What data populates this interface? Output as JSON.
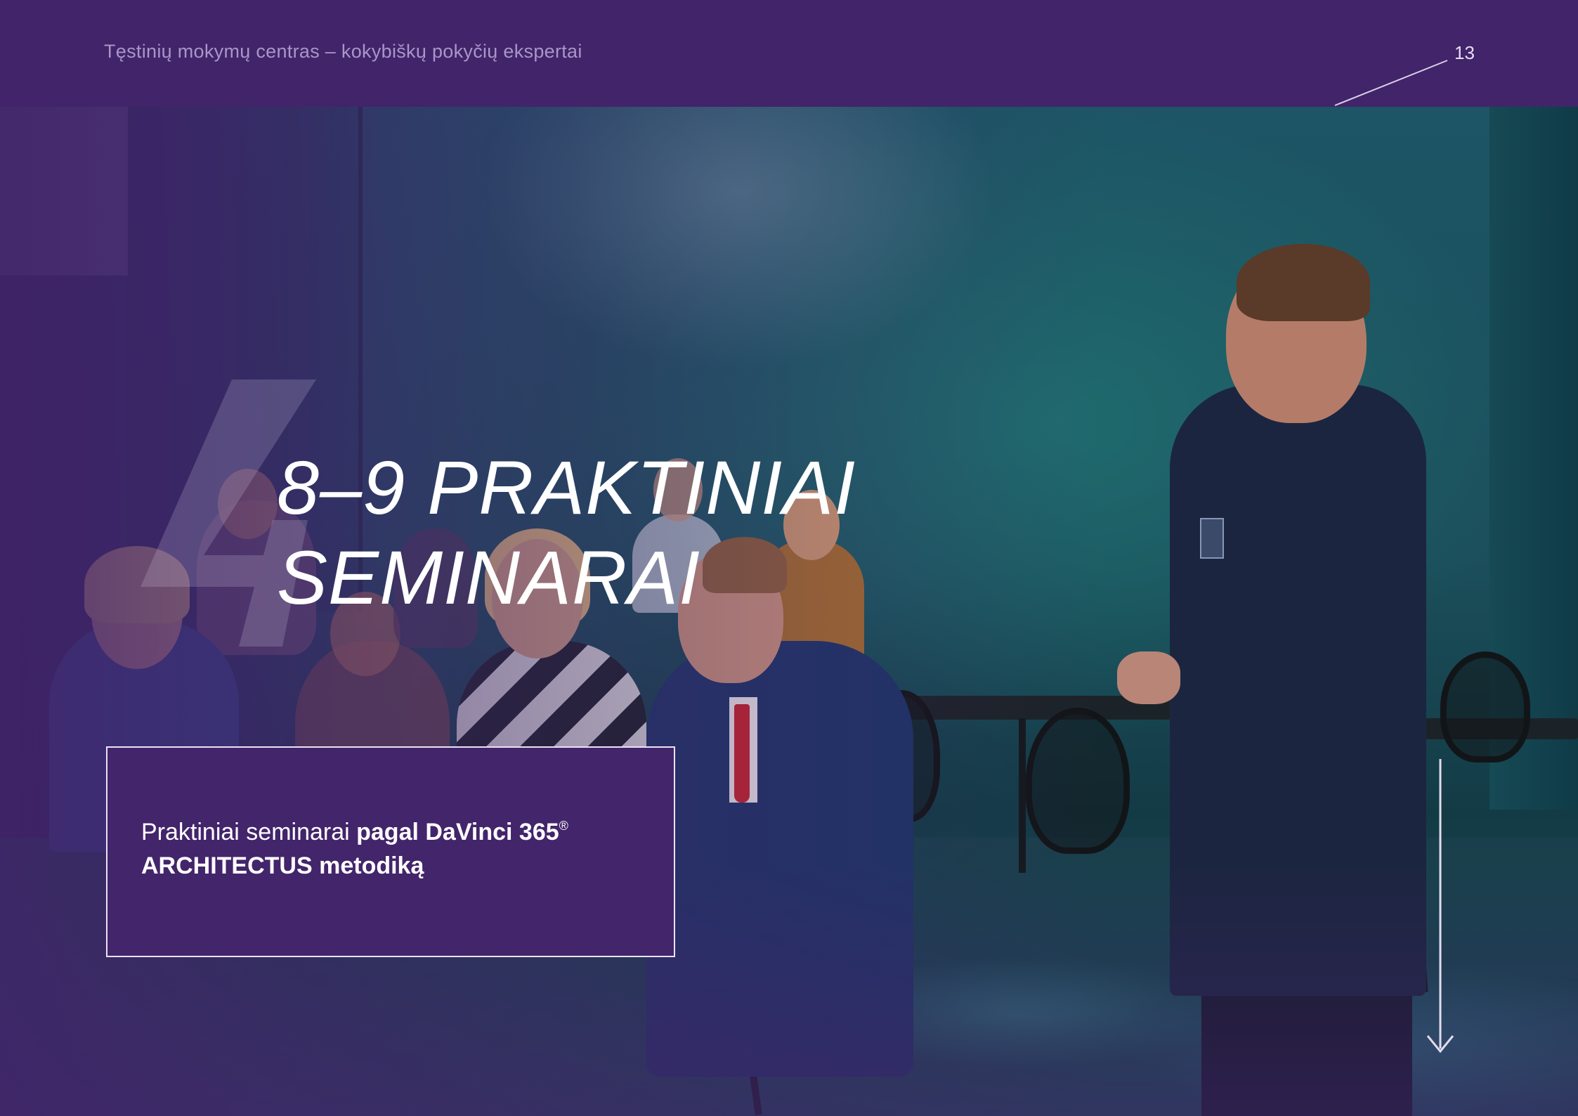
{
  "header": {
    "tagline": "Tęstinių mokymų centras – kokybiškų pokyčių ekspertai",
    "page_number": "13"
  },
  "section": {
    "numeral": "4",
    "title_line1": "8–9 PRAKTINIAI",
    "title_line2": "SEMINARAI"
  },
  "caption": {
    "regular": "Praktiniai seminarai ",
    "bold_1": "pagal DaVinci 365",
    "registered_mark": "®",
    "bold_2": "ARCHITECTUS metodiką"
  },
  "icons": {
    "header_accent": "diagonal-line-icon",
    "scroll": "arrow-down-icon"
  },
  "colors": {
    "brand_purple": "#42246a",
    "caption_background": "#43256b",
    "tagline_text": "#a996c8",
    "title_text": "#ffffff"
  }
}
